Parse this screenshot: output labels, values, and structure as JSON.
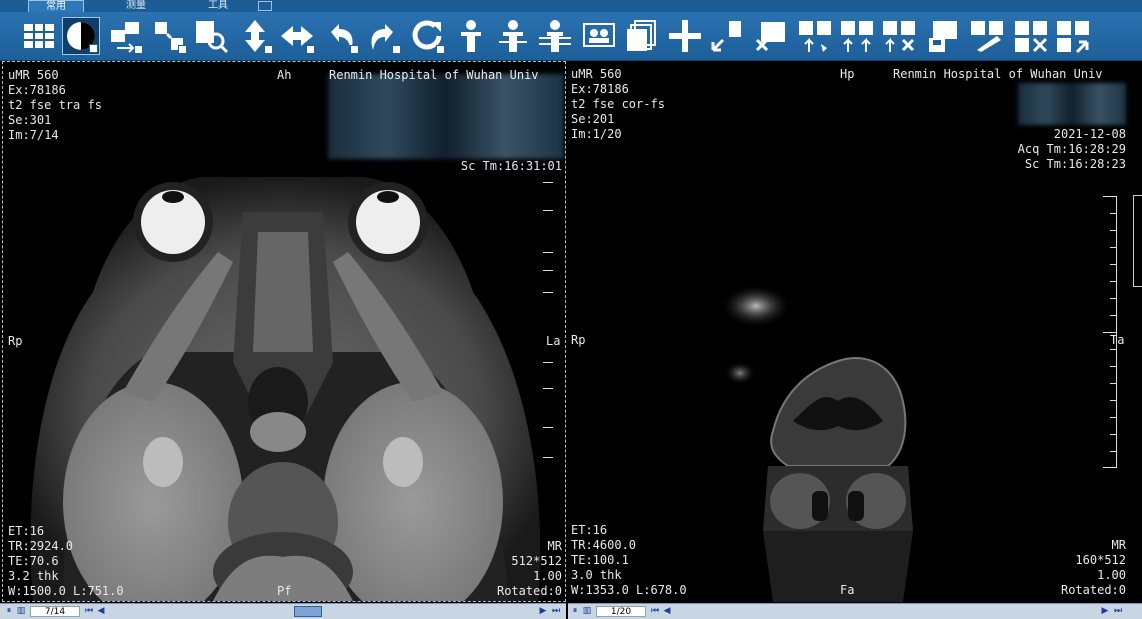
{
  "tabs": [
    "常用",
    "测量",
    "工具"
  ],
  "toolbar": {
    "icons": [
      "layout-grid-icon",
      "window-level-icon",
      "swap-series-icon",
      "link-series-icon",
      "zoom-icon",
      "pan-vertical-icon",
      "pan-horizontal-icon",
      "undo-icon",
      "redo-icon",
      "reset-icon",
      "person-icon",
      "person-split-icon",
      "person-lines-icon",
      "image-compare-icon",
      "stack-icon",
      "crosshair-icon",
      "pointer-icon",
      "remove-series-icon",
      "series-up-icon",
      "series-sync-icon",
      "series-delete-icon",
      "save-icon",
      "edit-icon",
      "grid-delete-icon",
      "export-icon"
    ]
  },
  "left_view": {
    "modality": "uMR 560",
    "exam": "Ex:78186",
    "sequence": "t2 fse tra fs",
    "series": "Se:301",
    "image": "Im:7/14",
    "orient_top": "Ah",
    "hospital": "Renmin Hospital of Wuhan Univ",
    "scan_time": "Sc Tm:16:31:01",
    "orient_left": "Rp",
    "orient_right": "La",
    "et": "ET:16",
    "tr": "TR:2924.0",
    "te": "TE:70.6",
    "thk": "3.2 thk",
    "wl": "W:1500.0 L:751.0",
    "orient_bottom": "Pf",
    "mod_type": "MR",
    "matrix": "512*512",
    "zoom": "1.00",
    "rotated": "Rotated:0",
    "page": "7/14"
  },
  "right_view": {
    "modality": "uMR 560",
    "exam": "Ex:78186",
    "sequence": "t2 fse cor-fs",
    "series": "Se:201",
    "image": "Im:1/20",
    "orient_top": "Hp",
    "hospital": "Renmin Hospital of Wuhan Univ",
    "date": "2021-12-08",
    "acq_time": "Acq Tm:16:28:29",
    "scan_time": "Sc Tm:16:28:23",
    "orient_left": "Rp",
    "orient_right": "Ta",
    "et": "ET:16",
    "tr": "TR:4600.0",
    "te": "TE:100.1",
    "thk": "3.0 thk",
    "wl": "W:1353.0 L:678.0",
    "orient_bottom": "Fa",
    "mod_type": "MR",
    "matrix": "160*512",
    "zoom": "1.00",
    "rotated": "Rotated:0",
    "page": "1/20"
  },
  "colors": {
    "toolbar": "#2167a5",
    "overlay_text": "#e9e9e9",
    "status": "#c8d6e4"
  }
}
